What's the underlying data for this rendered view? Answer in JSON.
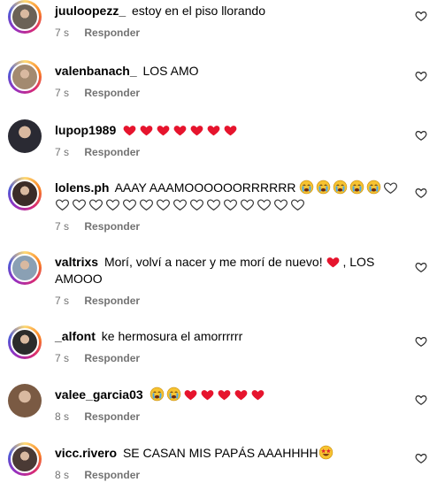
{
  "colors": {
    "heart_red": "#e6142d",
    "meta_gray": "#737373",
    "ring_start": "#feda75",
    "ring_end": "#962fbf"
  },
  "comments": [
    {
      "username": "juuloopezz_",
      "text": "estoy en el piso llorando",
      "time": "7 s",
      "reply": "Responder",
      "avatar_ring": true,
      "avatar_color": "#6b6257"
    },
    {
      "username": "valenbanach_",
      "text": "LOS AMO",
      "time": "7 s",
      "reply": "Responder",
      "avatar_ring": true,
      "avatar_color": "#a38a70"
    },
    {
      "username": "lupop1989",
      "text": "",
      "emojis": [
        "red-heart",
        "red-heart",
        "red-heart",
        "red-heart",
        "red-heart",
        "red-heart",
        "red-heart"
      ],
      "time": "7 s",
      "reply": "Responder",
      "avatar_ring": false,
      "avatar_color": "#2a2a33"
    },
    {
      "username": "lolens.ph",
      "text": "AAAY AAAMOOOOOORRRRRR",
      "emojis": [
        "crying-face",
        "crying-face",
        "crying-face",
        "crying-face",
        "crying-face",
        "white-heart",
        "white-heart",
        "white-heart",
        "white-heart",
        "white-heart",
        "white-heart",
        "white-heart",
        "white-heart",
        "white-heart",
        "white-heart",
        "white-heart",
        "white-heart",
        "white-heart",
        "white-heart",
        "white-heart",
        "white-heart"
      ],
      "time": "7 s",
      "reply": "Responder",
      "avatar_ring": true,
      "avatar_color": "#3b2c28"
    },
    {
      "username": "valtrixs",
      "text": "Morí, volví a nacer y me morí de nuevo!",
      "text_after": ", LOS AMOOO",
      "emojis": [
        "red-heart"
      ],
      "time": "7 s",
      "reply": "Responder",
      "avatar_ring": true,
      "avatar_color": "#8aa0b4"
    },
    {
      "username": "_alfont",
      "text": "ke hermosura el amorrrrrr",
      "time": "7 s",
      "reply": "Responder",
      "avatar_ring": true,
      "avatar_color": "#2b2b2b"
    },
    {
      "username": "valee_garcia03",
      "text": "",
      "emojis": [
        "crying-face",
        "crying-face",
        "red-heart",
        "red-heart",
        "red-heart",
        "red-heart",
        "red-heart"
      ],
      "time": "8 s",
      "reply": "Responder",
      "avatar_ring": false,
      "avatar_color": "#7a5a43"
    },
    {
      "username": "vicc.rivero",
      "text": "SE CASAN MIS PAPÁS AAAHHHH",
      "emojis": [
        "star-struck-face"
      ],
      "time": "8 s",
      "reply": "Responder",
      "avatar_ring": true,
      "avatar_color": "#4a3a35"
    }
  ]
}
